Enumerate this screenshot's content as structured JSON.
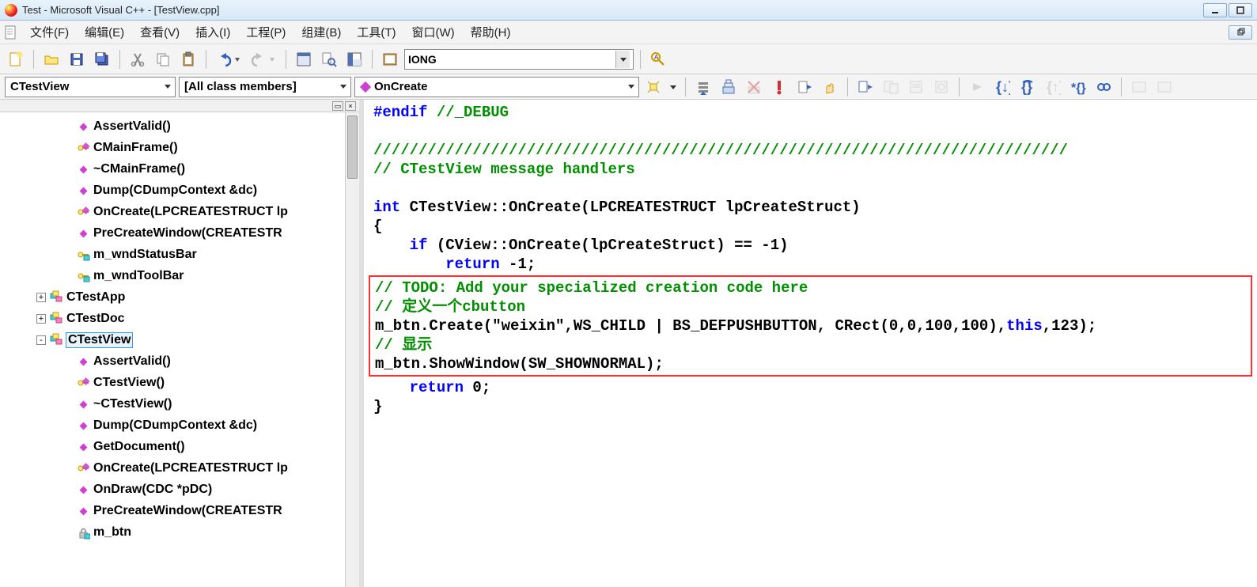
{
  "title": "Test - Microsoft Visual C++ - [TestView.cpp]",
  "menu": {
    "file": "文件(F)",
    "edit": "编辑(E)",
    "view": "查看(V)",
    "insert": "插入(I)",
    "project": "工程(P)",
    "build": "组建(B)",
    "tools": "工具(T)",
    "window": "窗口(W)",
    "help": "帮助(H)"
  },
  "combos": {
    "search": "IONG",
    "class": "CTestView",
    "members": "[All class members]",
    "func": "OnCreate"
  },
  "tree": {
    "items_top": [
      {
        "icon": "diamond",
        "label": "AssertValid()"
      },
      {
        "icon": "key",
        "label": "CMainFrame()"
      },
      {
        "icon": "diamond",
        "label": "~CMainFrame()"
      },
      {
        "icon": "diamond",
        "label": "Dump(CDumpContext &dc)"
      },
      {
        "icon": "key",
        "label": "OnCreate(LPCREATESTRUCT lp"
      },
      {
        "icon": "diamond",
        "label": "PreCreateWindow(CREATESTR"
      },
      {
        "icon": "key-var",
        "label": "m_wndStatusBar"
      },
      {
        "icon": "key-var",
        "label": "m_wndToolBar"
      }
    ],
    "classes": [
      {
        "expand": "+",
        "label": "CTestApp"
      },
      {
        "expand": "+",
        "label": "CTestDoc"
      },
      {
        "expand": "-",
        "label": "CTestView",
        "selected": true
      }
    ],
    "items_bottom": [
      {
        "icon": "diamond",
        "label": "AssertValid()"
      },
      {
        "icon": "key",
        "label": "CTestView()"
      },
      {
        "icon": "diamond",
        "label": "~CTestView()"
      },
      {
        "icon": "diamond",
        "label": "Dump(CDumpContext &dc)"
      },
      {
        "icon": "diamond",
        "label": "GetDocument()"
      },
      {
        "icon": "key",
        "label": "OnCreate(LPCREATESTRUCT lp"
      },
      {
        "icon": "diamond",
        "label": "OnDraw(CDC *pDC)"
      },
      {
        "icon": "diamond",
        "label": "PreCreateWindow(CREATESTR"
      },
      {
        "icon": "lock",
        "label": "m_btn"
      }
    ]
  },
  "code": {
    "l1": "#endif",
    "l1c": " //_DEBUG",
    "l3": "/////////////////////////////////////////////////////////////////////////////",
    "l4": "// CTestView message handlers",
    "l6a": "int",
    "l6b": " CTestView::OnCreate(LPCREATESTRUCT lpCreateStruct)",
    "l7": "{",
    "l8a": "    ",
    "l8b": "if",
    "l8c": " (CView::OnCreate(lpCreateStruct) == -1)",
    "l9a": "        ",
    "l9b": "return",
    "l9c": " -1;",
    "box1": "// TODO: Add your specialized creation code here",
    "box2": "// 定义一个cbutton",
    "box3a": "m_btn.Create(\"weixin\",WS_CHILD | BS_DEFPUSHBUTTON, CRect(0,0,100,100),",
    "box3b": "this",
    "box3c": ",123);",
    "box4": "// 显示",
    "box5": "m_btn.ShowWindow(SW_SHOWNORMAL);",
    "l15a": "    ",
    "l15b": "return",
    "l15c": " 0;",
    "l16": "}"
  }
}
